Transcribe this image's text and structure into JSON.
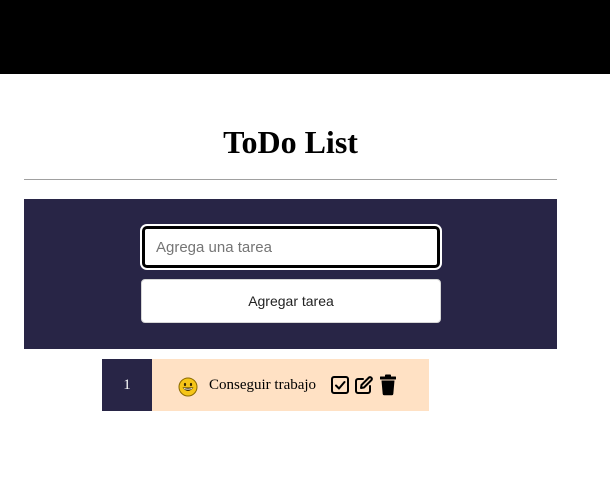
{
  "header": {
    "title": "ToDo List"
  },
  "form": {
    "placeholder": "Agrega una tarea",
    "value": "",
    "add_button_label": "Agregar tarea"
  },
  "tasks": [
    {
      "number": "1",
      "text": "Conseguir trabajo",
      "icon": "grinning-face-emoji",
      "actions": [
        "check-square-icon",
        "edit-icon",
        "trash-icon"
      ]
    }
  ],
  "colors": {
    "top_bar": "#000000",
    "panel": "#282546",
    "task_background": "#ffe1c4",
    "emoji": "#f5c518"
  }
}
